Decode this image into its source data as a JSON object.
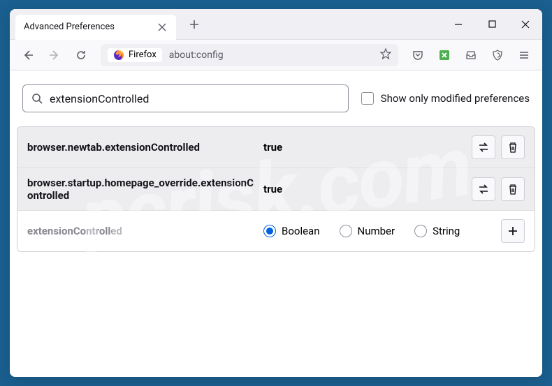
{
  "window": {
    "tab_title": "Advanced Preferences"
  },
  "toolbar": {
    "identity": "Firefox",
    "url": "about:config"
  },
  "search": {
    "value": "extensionControlled",
    "checkbox_label": "Show only modified preferences"
  },
  "prefs": [
    {
      "name": "browser.newtab.extensionControlled",
      "value": "true"
    },
    {
      "name": "browser.startup.homepage_override.extensionControlled",
      "value": "true"
    }
  ],
  "newpref": {
    "name": "extensionControlled",
    "options": {
      "boolean": "Boolean",
      "number": "Number",
      "string": "String"
    }
  },
  "watermark": "pcrisk.com"
}
